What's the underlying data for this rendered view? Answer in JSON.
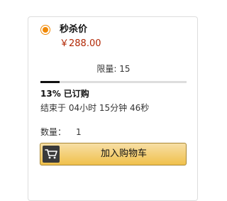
{
  "deal": {
    "title": "秒杀价",
    "price": "￥288.00",
    "selected": true,
    "accent_color": "#f08804",
    "price_color": "#b12704"
  },
  "limit": {
    "text": "限量: 15",
    "progress_percent": 13
  },
  "claimed": {
    "percent_text": "13%",
    "label": "已订购"
  },
  "countdown": {
    "text": "结束于 04小时 15分钟 46秒"
  },
  "quantity": {
    "label": "数量：",
    "value": "1"
  },
  "cart": {
    "icon": "cart-icon",
    "label": "加入购物车"
  }
}
